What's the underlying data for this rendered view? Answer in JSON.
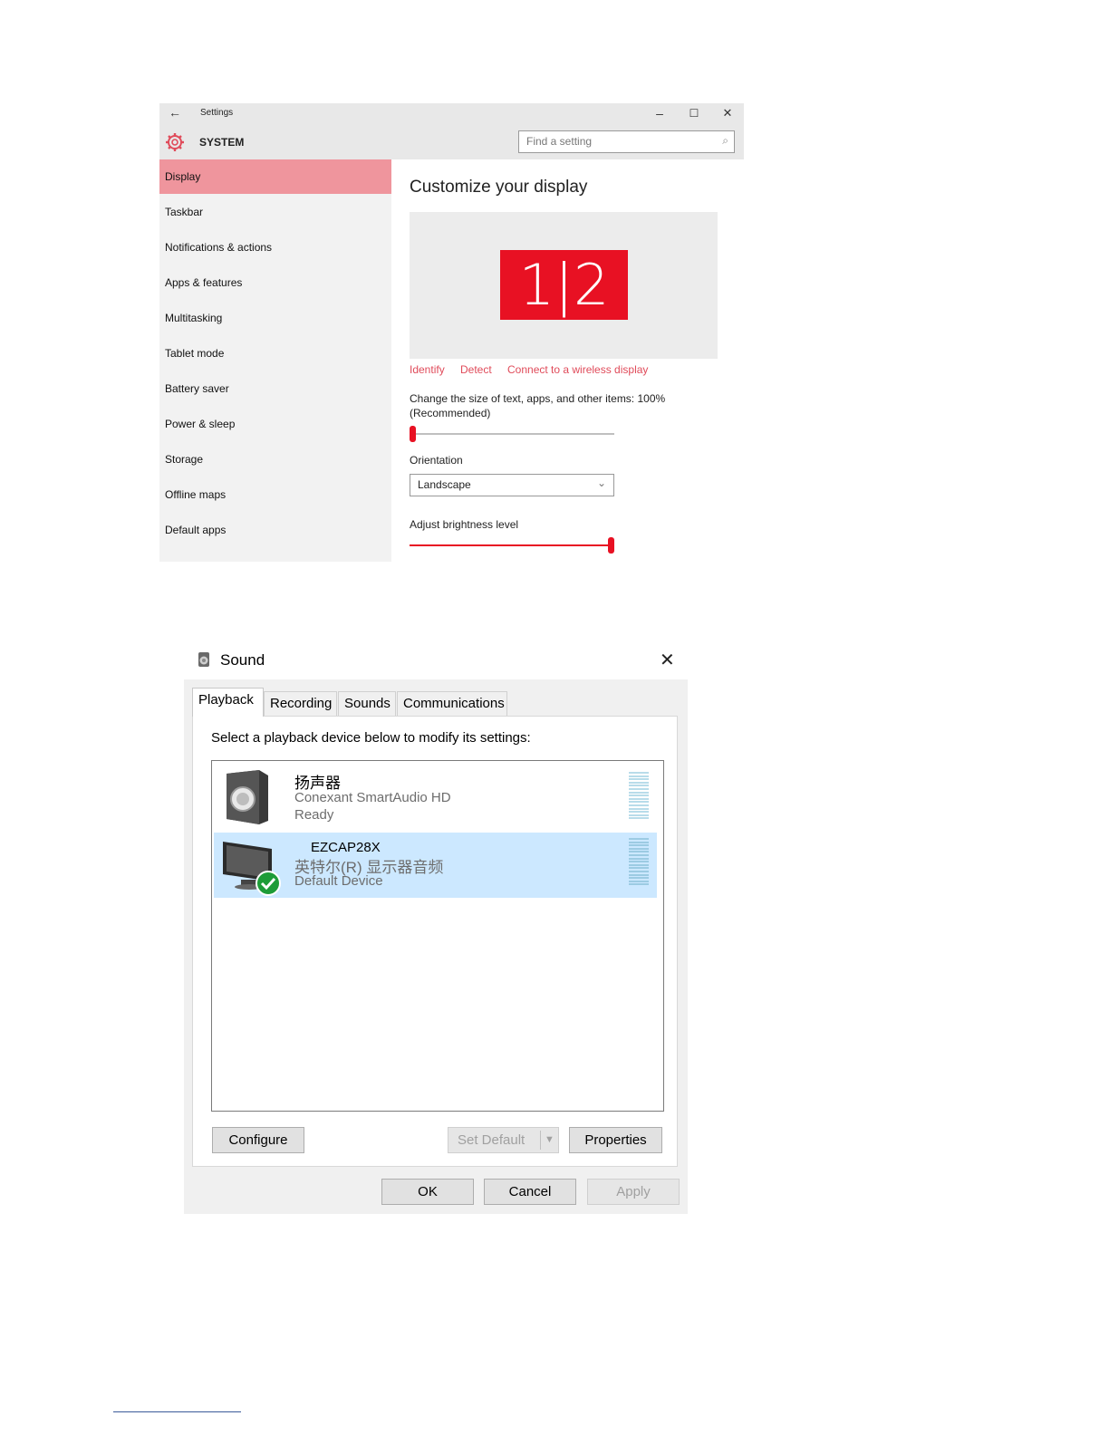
{
  "settings": {
    "title": "Settings",
    "section": "SYSTEM",
    "search_placeholder": "Find a setting",
    "controls": {
      "minimize": "–",
      "maximize": "☐",
      "close": "✕",
      "back": "←"
    },
    "sidebar": [
      {
        "label": "Display",
        "active": true
      },
      {
        "label": "Taskbar"
      },
      {
        "label": "Notifications & actions"
      },
      {
        "label": "Apps & features"
      },
      {
        "label": "Multitasking"
      },
      {
        "label": "Tablet mode"
      },
      {
        "label": "Battery saver"
      },
      {
        "label": "Power & sleep"
      },
      {
        "label": "Storage"
      },
      {
        "label": "Offline maps"
      },
      {
        "label": "Default apps"
      }
    ],
    "main": {
      "title": "Customize your display",
      "monitor_label": "1|2",
      "links": {
        "identify": "Identify",
        "detect": "Detect",
        "connect": "Connect to a wireless display"
      },
      "scale_label_line1": "Change the size of text, apps, and other items: 100%",
      "scale_label_line2": "(Recommended)",
      "scale_level": 0,
      "orientation_label": "Orientation",
      "orientation_value": "Landscape",
      "brightness_label": "Adjust brightness level",
      "brightness_level": 1.0
    },
    "accent_color": "#e81123"
  },
  "sound": {
    "title": "Sound",
    "close": "✕",
    "tabs": [
      "Playback",
      "Recording",
      "Sounds",
      "Communications"
    ],
    "active_tab": "Playback",
    "instruction": "Select a playback device below to modify its settings:",
    "devices": [
      {
        "name": "扬声器",
        "driver": "Conexant SmartAudio HD",
        "status": "Ready",
        "selected": false
      },
      {
        "name": "EZCAP28X",
        "driver": "英特尔(R) 显示器音频",
        "status": "Default Device",
        "selected": true
      }
    ],
    "buttons": {
      "configure": "Configure",
      "set_default": "Set Default",
      "properties": "Properties",
      "ok": "OK",
      "cancel": "Cancel",
      "apply": "Apply"
    }
  }
}
